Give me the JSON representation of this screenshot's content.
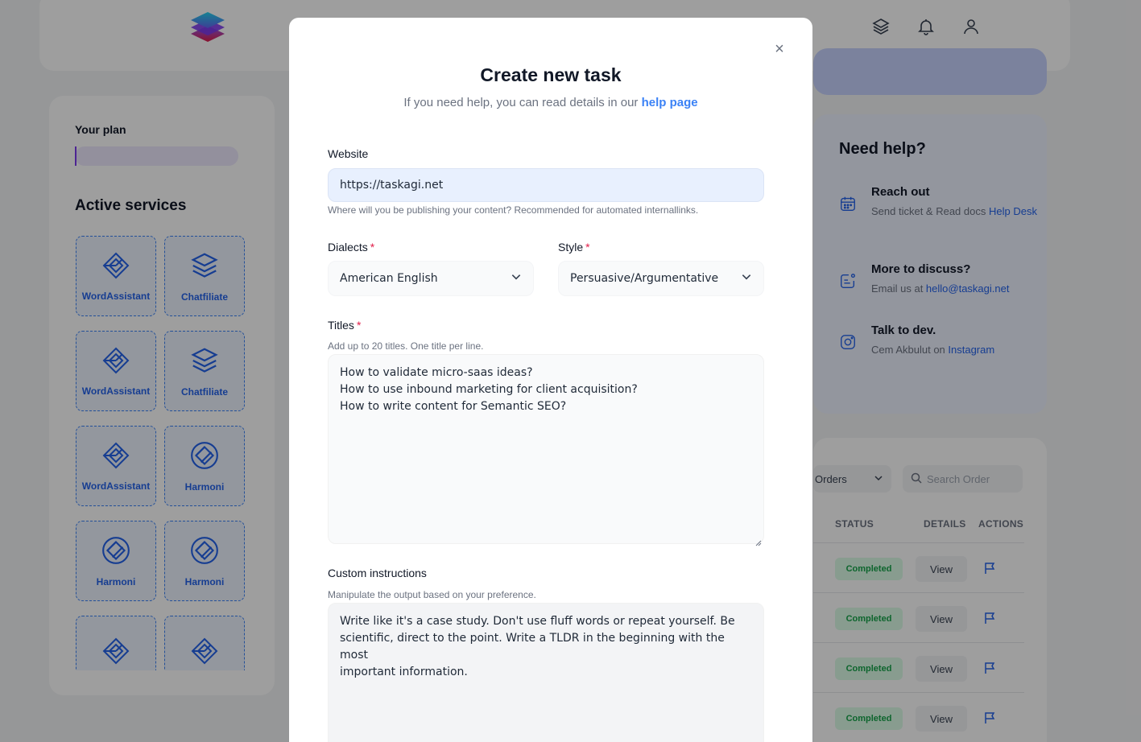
{
  "header": {
    "icons": [
      "layers-icon",
      "bell-icon",
      "user-icon"
    ]
  },
  "sidebar": {
    "plan_label": "Your plan",
    "plan_progress": 0.01,
    "services_title": "Active services",
    "services": [
      {
        "label": "WordAssistant",
        "icon": "wordassistant-icon"
      },
      {
        "label": "Chatfiliate",
        "icon": "layers-icon"
      },
      {
        "label": "WordAssistant",
        "icon": "wordassistant-icon"
      },
      {
        "label": "Chatfiliate",
        "icon": "layers-icon"
      },
      {
        "label": "WordAssistant",
        "icon": "wordassistant-icon"
      },
      {
        "label": "Harmoni",
        "icon": "harmoni-icon"
      },
      {
        "label": "Harmoni",
        "icon": "harmoni-icon"
      },
      {
        "label": "Harmoni",
        "icon": "harmoni-icon"
      },
      {
        "label": "",
        "icon": "wordassistant-icon"
      },
      {
        "label": "",
        "icon": "wordassistant-icon"
      }
    ]
  },
  "help": {
    "title": "Need help?",
    "items": [
      {
        "title": "Reach out",
        "text": "Send ticket & Read docs ",
        "link": "Help Desk",
        "icon": "calendar-icon"
      },
      {
        "title": "More to discuss?",
        "text": "Email us at ",
        "link": "hello@taskagi.net",
        "icon": "chat-icon"
      },
      {
        "title": "Talk to dev.",
        "text": "Cem Akbulut on ",
        "link": "Instagram",
        "icon": "instagram-icon"
      }
    ]
  },
  "orders": {
    "filter_label": "Orders",
    "search_placeholder": "Search Order",
    "headers": {
      "status": "STATUS",
      "details": "DETAILS",
      "actions": "ACTIONS"
    },
    "rows": [
      {
        "status": "Completed",
        "view": "View"
      },
      {
        "status": "Completed",
        "view": "View"
      },
      {
        "status": "Completed",
        "view": "View"
      },
      {
        "status": "Completed",
        "view": "View"
      }
    ]
  },
  "modal": {
    "title": "Create new task",
    "subtitle": "If you need help, you can read details in our ",
    "subtitle_link": "help page",
    "website": {
      "label": "Website",
      "value": "https://taskagi.net",
      "hint": "Where will you be publishing your content? Recommended for automated internallinks."
    },
    "dialects": {
      "label": "Dialects",
      "value": "American English"
    },
    "style": {
      "label": "Style",
      "value": "Persuasive/Argumentative"
    },
    "titles": {
      "label": "Titles",
      "hint": "Add up to 20 titles. One title per line.",
      "lines": [
        "How to validate micro-saas ideas?",
        "How to use inbound marketing for client acquisition?",
        "How to write content for Semantic SEO?"
      ]
    },
    "custom": {
      "label": "Custom instructions",
      "hint": "Manipulate the output based on your preference.",
      "lines": [
        "Write like it's a case study. Don't use fluff words or repeat yourself. Be",
        "scientific, direct to the point. Write a TLDR in the beginning with the most",
        "important information."
      ]
    },
    "required_mark": "*",
    "close_glyph": "×"
  },
  "colors": {
    "accent": "#3b82f6",
    "required": "#e11d48",
    "success": "#16a34a"
  }
}
